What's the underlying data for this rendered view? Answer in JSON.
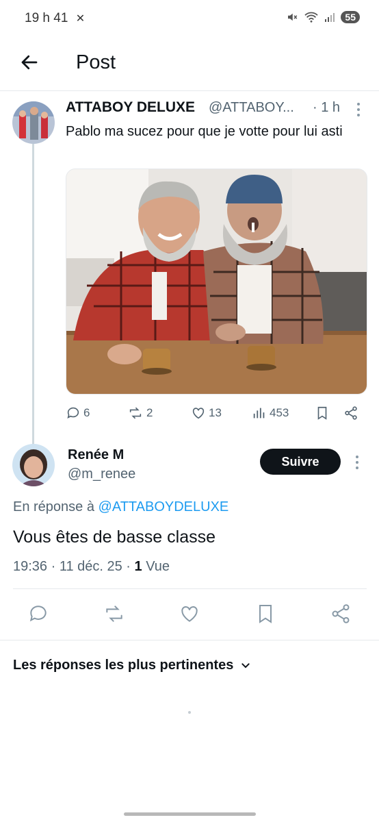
{
  "status_bar": {
    "time": "19 h 41",
    "battery": "55"
  },
  "header": {
    "title": "Post"
  },
  "parent_tweet": {
    "author_name": "ATTABOY DELUXE",
    "author_handle": "@ATTABOY...",
    "time": "· 1 h",
    "text": "Pablo ma sucez pour que je votte pour lui asti",
    "actions": {
      "replies": "6",
      "retweets": "2",
      "likes": "13",
      "views": "453"
    }
  },
  "reply_tweet": {
    "author_name": "Renée M",
    "author_handle": "@m_renee",
    "follow_label": "Suivre",
    "reply_prefix": "En réponse à",
    "reply_mention": "@ATTABOYDELUXE",
    "text": "Vous êtes de basse classe",
    "timestamp": "19:36 · 11 déc. 25 · ",
    "views_count": "1",
    "views_label": " Vue"
  },
  "replies_sort": {
    "label": "Les réponses les plus pertinentes"
  },
  "colors": {
    "accent": "#1d9bf0",
    "text": "#0f1419",
    "secondary": "#536471"
  }
}
